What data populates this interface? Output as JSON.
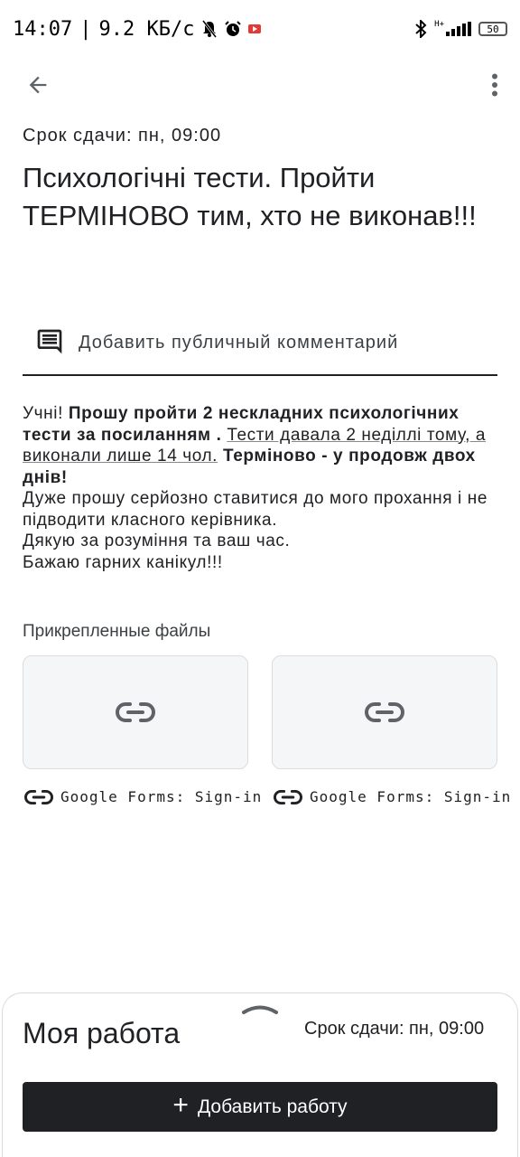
{
  "status_bar": {
    "time": "14:07",
    "separator": "|",
    "speed": "9.2 КБ/с",
    "network_label": "H+",
    "battery": "50"
  },
  "assignment": {
    "due": "Срок сдачи: пн, 09:00",
    "title": "Психологічні тести. Пройти ТЕРМІНОВО тим, хто не виконав!!!",
    "comment_placeholder": "Добавить публичный комментарий",
    "body": {
      "p1_normal": "Учні! ",
      "p1_bold": "Прошу пройти 2 нескладних психологічних тести за посиланням",
      "p1_dot": " . ",
      "p1_underlined": "Тести давала 2 неділлі тому, а виконали лише 14 чол.",
      "p1_bold2": " Терміново -   у продовж двох днів!",
      "line2": "Дуже прошу серйозно ставитися до мого прохання і не підводити класного керівника.",
      "line3": "Дякую за розуміння та ваш час.",
      "line4": "Бажаю гарних канікул!!!"
    }
  },
  "attachments": {
    "heading": "Прикрепленные файлы",
    "items": [
      {
        "label": "Google Forms: Sign-in",
        "icon": "link-icon"
      },
      {
        "label": "Google Forms: Sign-in",
        "icon": "link-icon"
      }
    ]
  },
  "my_work": {
    "title": "Моя работа",
    "due": "Срок сдачи: пн, 09:00",
    "add_button": "Добавить работу",
    "add_icon": "+"
  }
}
